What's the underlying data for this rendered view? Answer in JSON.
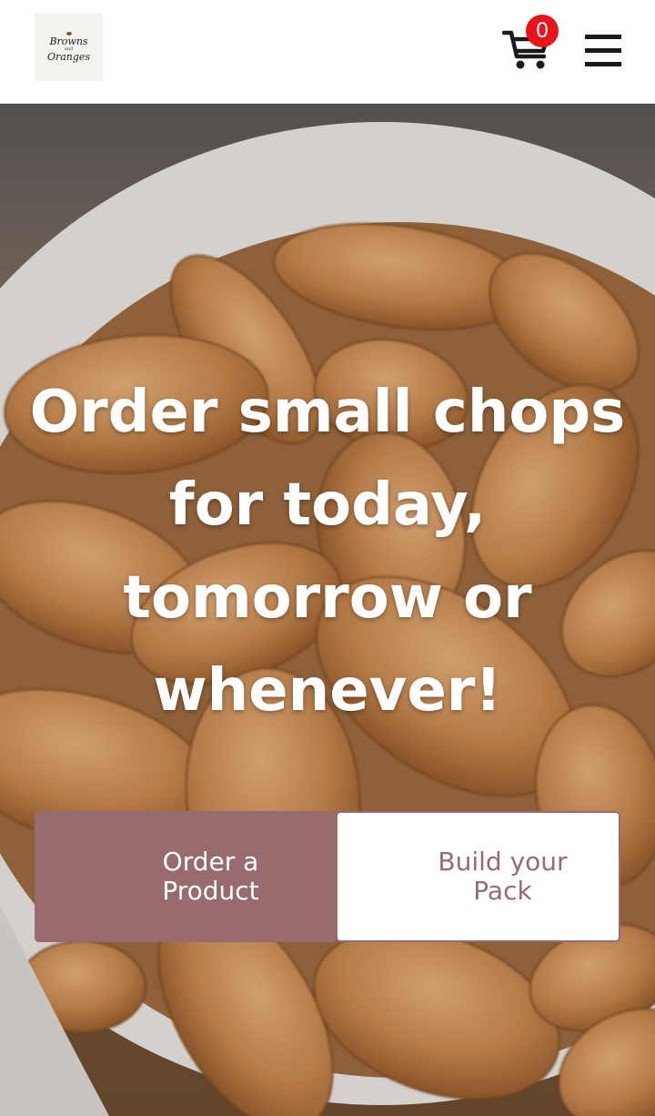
{
  "header": {
    "logo": {
      "line1": "Browns",
      "line2": "and",
      "line3": "Oranges"
    },
    "cart": {
      "count": "0",
      "icon": "cart-icon",
      "badge_color": "#e8141c"
    },
    "menu": {
      "icon": "hamburger-menu-icon"
    }
  },
  "hero": {
    "background": "almonds-in-bowl-photo",
    "title_lines": [
      "Order small chops",
      "for today,",
      "tomorrow or",
      "whenever!"
    ],
    "buttons": {
      "order": {
        "line1": "Order a",
        "line2": "Product",
        "bg_color": "#986b6e"
      },
      "build": {
        "line1": "Build your",
        "line2": "Pack",
        "text_color": "#986b6e"
      }
    }
  }
}
